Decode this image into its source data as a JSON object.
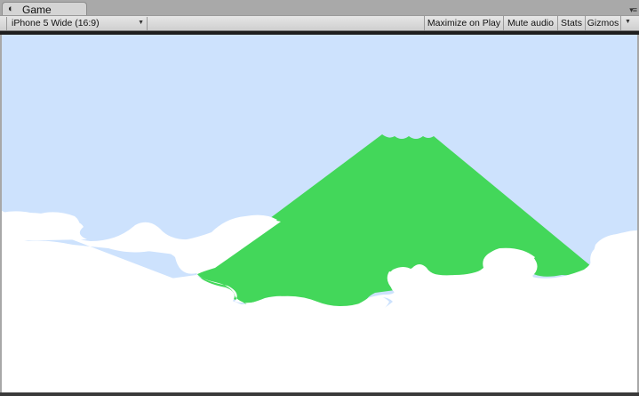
{
  "window": {
    "tab_title": "Game",
    "tab_icon": "unity-icon",
    "tab_menu_icon": "panel-menu-icon"
  },
  "toolbar": {
    "aspect_ratio": "iPhone 5 Wide (16:9)",
    "maximize_on_play": "Maximize on Play",
    "mute_audio": "Mute audio",
    "stats": "Stats",
    "gizmos": "Gizmos"
  },
  "scene": {
    "sky_color": "#cde2fd",
    "mountain_color": "#43d75a",
    "cloud_color": "#ffffff"
  }
}
